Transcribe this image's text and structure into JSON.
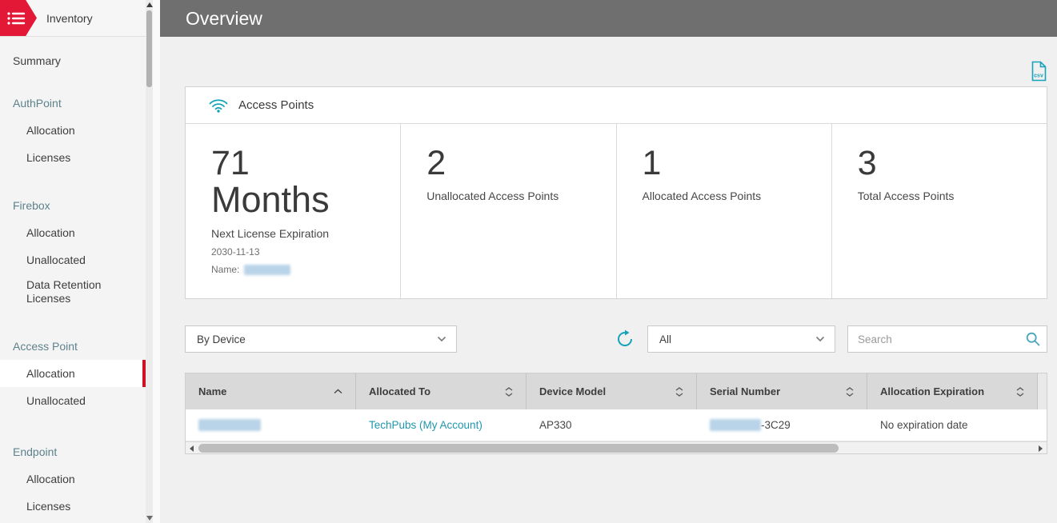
{
  "colors": {
    "brand_red": "#e31837",
    "accent_teal": "#14a3b8",
    "link_teal": "#1f97ad"
  },
  "sidebar": {
    "title": "Inventory",
    "summary_label": "Summary",
    "sections": [
      {
        "label": "AuthPoint",
        "items": [
          {
            "label": "Allocation"
          },
          {
            "label": "Licenses"
          }
        ]
      },
      {
        "label": "Firebox",
        "items": [
          {
            "label": "Allocation"
          },
          {
            "label": "Unallocated"
          },
          {
            "label": "Data Retention Licenses"
          }
        ]
      },
      {
        "label": "Access Point",
        "items": [
          {
            "label": "Allocation",
            "selected": true
          },
          {
            "label": "Unallocated"
          }
        ]
      },
      {
        "label": "Endpoint",
        "items": [
          {
            "label": "Allocation"
          },
          {
            "label": "Licenses"
          }
        ]
      }
    ]
  },
  "header": {
    "title": "Overview"
  },
  "export": {
    "icon_label": "csv"
  },
  "card": {
    "title": "Access Points"
  },
  "stats": {
    "license": {
      "value": "71",
      "unit": "Months",
      "label": "Next License Expiration",
      "date": "2030-11-13",
      "name_label": "Name:"
    },
    "counts": [
      {
        "value": "2",
        "label": "Unallocated Access Points"
      },
      {
        "value": "1",
        "label": "Allocated Access Points"
      },
      {
        "value": "3",
        "label": "Total Access Points"
      }
    ]
  },
  "filters": {
    "group_by": "By Device",
    "scope": "All",
    "search_placeholder": "Search"
  },
  "table": {
    "columns": [
      {
        "label": "Name",
        "sort": "asc"
      },
      {
        "label": "Allocated To",
        "sort": "both"
      },
      {
        "label": "Device Model",
        "sort": "both"
      },
      {
        "label": "Serial Number",
        "sort": "both"
      },
      {
        "label": "Allocation Expiration",
        "sort": "both"
      }
    ],
    "rows": [
      {
        "allocated_to": "TechPubs (My Account)",
        "device_model": "AP330",
        "serial_suffix": "-3C29",
        "allocation_expiration": "No expiration date"
      }
    ]
  }
}
